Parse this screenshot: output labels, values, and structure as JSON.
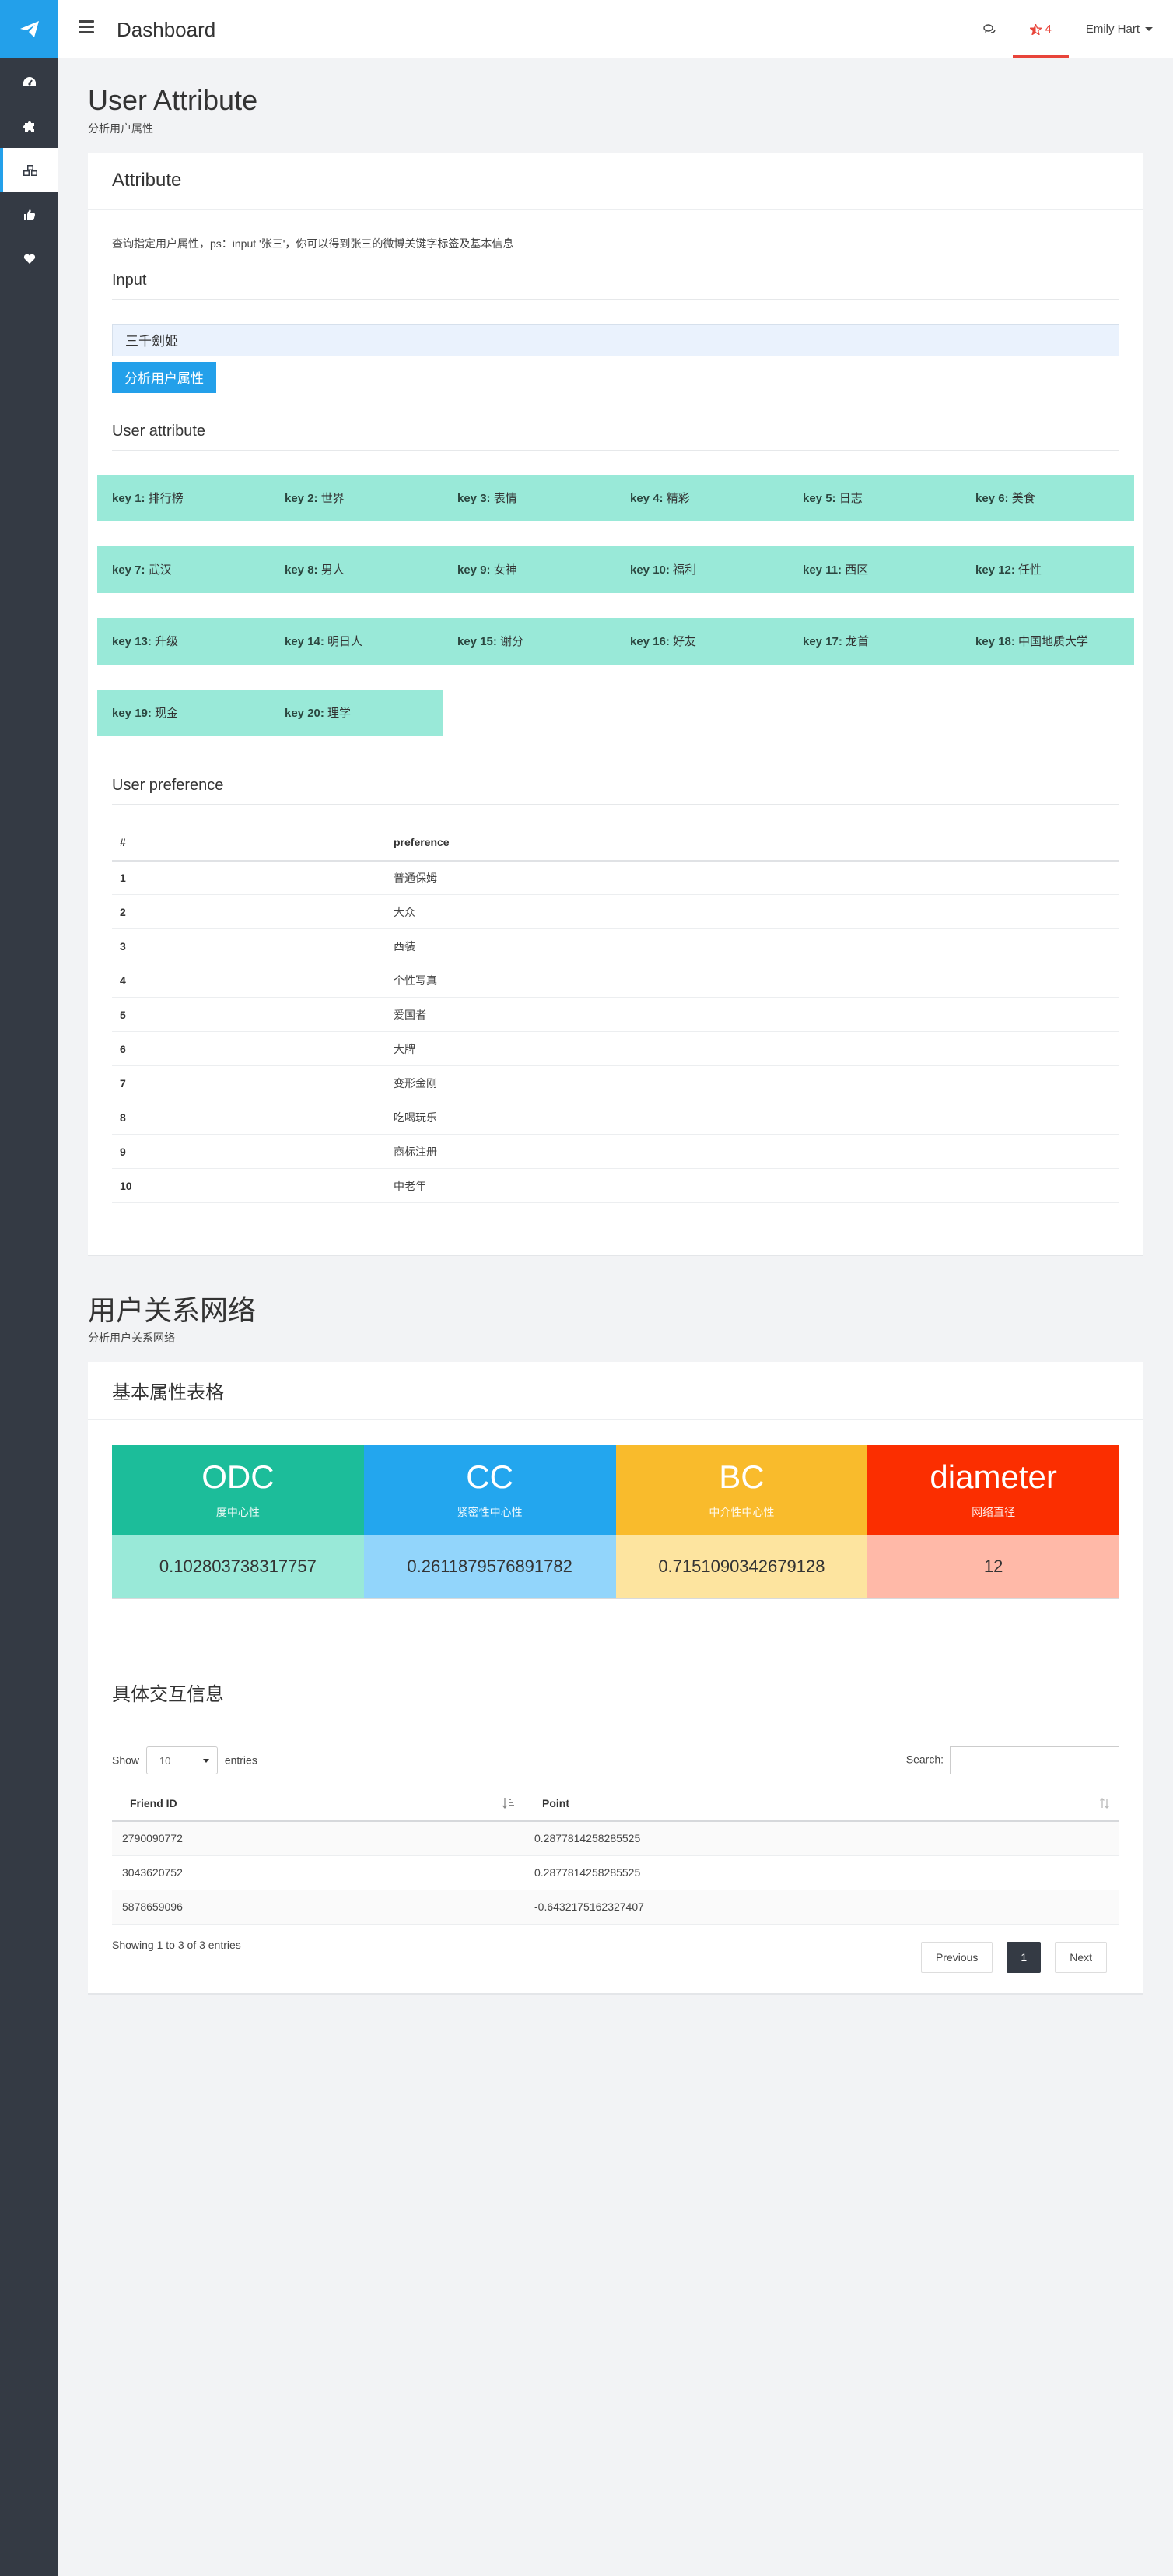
{
  "topbar": {
    "title": "Dashboard",
    "alert_count": "4",
    "user_name": "Emily Hart"
  },
  "attr_section": {
    "title": "User Attribute",
    "subtitle": "分析用户属性",
    "card_title": "Attribute",
    "help_text": "查询指定用户属性，ps：input '张三'，你可以得到张三的微博关键字标签及基本信息",
    "input_label": "Input",
    "input_value": "三千劍姬",
    "analyze_button": "分析用户属性",
    "attr_label": "User attribute",
    "keys": [
      [
        {
          "k": "key 1:",
          "v": "排行榜"
        },
        {
          "k": "key 2:",
          "v": "世界"
        },
        {
          "k": "key 3:",
          "v": "表情"
        },
        {
          "k": "key 4:",
          "v": "精彩"
        },
        {
          "k": "key 5:",
          "v": "日志"
        },
        {
          "k": "key 6:",
          "v": "美食"
        }
      ],
      [
        {
          "k": "key 7:",
          "v": "武汉"
        },
        {
          "k": "key 8:",
          "v": "男人"
        },
        {
          "k": "key 9:",
          "v": "女神"
        },
        {
          "k": "key 10:",
          "v": "福利"
        },
        {
          "k": "key 11:",
          "v": "西区"
        },
        {
          "k": "key 12:",
          "v": "任性"
        }
      ],
      [
        {
          "k": "key 13:",
          "v": "升级"
        },
        {
          "k": "key 14:",
          "v": "明日人"
        },
        {
          "k": "key 15:",
          "v": "谢分"
        },
        {
          "k": "key 16:",
          "v": "好友"
        },
        {
          "k": "key 17:",
          "v": "龙首"
        },
        {
          "k": "key 18:",
          "v": "中国地质大学"
        }
      ],
      [
        {
          "k": "key 19:",
          "v": "现金"
        },
        {
          "k": "key 20:",
          "v": "理学"
        }
      ]
    ],
    "pref_label": "User preference",
    "pref_headers": [
      "#",
      "preference"
    ],
    "prefs": [
      {
        "n": "1",
        "p": "普通保姆"
      },
      {
        "n": "2",
        "p": "大众"
      },
      {
        "n": "3",
        "p": "西装"
      },
      {
        "n": "4",
        "p": "个性写真"
      },
      {
        "n": "5",
        "p": "爱国者"
      },
      {
        "n": "6",
        "p": "大牌"
      },
      {
        "n": "7",
        "p": "变形金刚"
      },
      {
        "n": "8",
        "p": "吃喝玩乐"
      },
      {
        "n": "9",
        "p": "商标注册"
      },
      {
        "n": "10",
        "p": "中老年"
      }
    ]
  },
  "net_section": {
    "title": "用户关系网络",
    "subtitle": "分析用户关系网络",
    "card_title": "基本属性表格",
    "metrics": [
      {
        "abbr": "ODC",
        "name": "度中心性",
        "value": "0.102803738317757",
        "color": "#1cbd9a",
        "light": "#99e9d8"
      },
      {
        "abbr": "CC",
        "name": "紧密性中心性",
        "value": "0.2611879576891782",
        "color": "#23a6ee",
        "light": "#92d5fb"
      },
      {
        "abbr": "BC",
        "name": "中介性中心性",
        "value": "0.7151090342679128",
        "color": "#f9bb2c",
        "light": "#fde49f"
      },
      {
        "abbr": "diameter",
        "name": "网络直径",
        "value": "12",
        "color": "#fb2e00",
        "light": "#ffb9a8"
      }
    ],
    "interact_title": "具体交互信息",
    "show_label": "Show",
    "entries_value": "10",
    "entries_label": "entries",
    "search_label": "Search:",
    "columns": [
      "Friend ID",
      "Point"
    ],
    "rows": [
      {
        "id": "2790090772",
        "point": "0.2877814258285525"
      },
      {
        "id": "3043620752",
        "point": "0.2877814258285525"
      },
      {
        "id": "5878659096",
        "point": "-0.6432175162327407"
      }
    ],
    "info": "Showing 1 to 3 of 3 entries",
    "prev": "Previous",
    "page": "1",
    "next": "Next"
  }
}
